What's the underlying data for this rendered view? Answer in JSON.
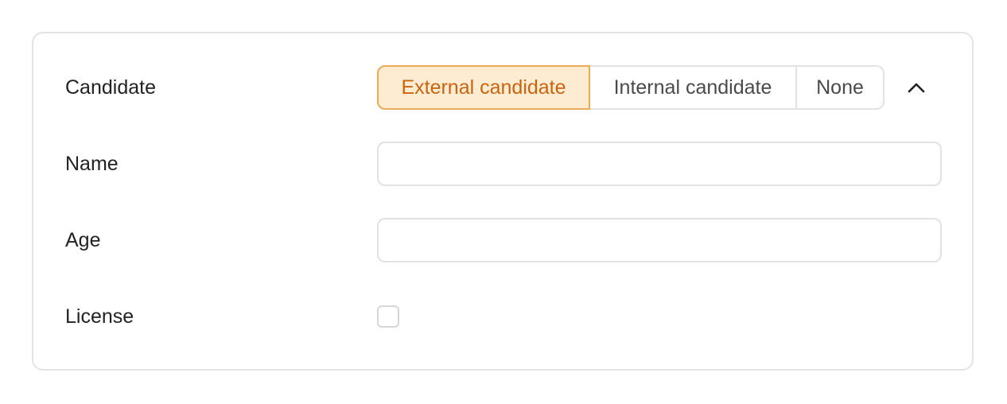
{
  "form": {
    "candidate": {
      "label": "Candidate",
      "options": [
        {
          "label": "External candidate",
          "selected": true
        },
        {
          "label": "Internal candidate",
          "selected": false
        },
        {
          "label": "None",
          "selected": false
        }
      ],
      "collapse_icon": "chevron-up-icon"
    },
    "name": {
      "label": "Name",
      "value": ""
    },
    "age": {
      "label": "Age",
      "value": ""
    },
    "license": {
      "label": "License",
      "checked": false
    }
  },
  "colors": {
    "accent_bg": "#fdebd2",
    "accent_border": "#e9ac5a",
    "accent_text": "#c9640e",
    "border": "#e2e2e2"
  }
}
